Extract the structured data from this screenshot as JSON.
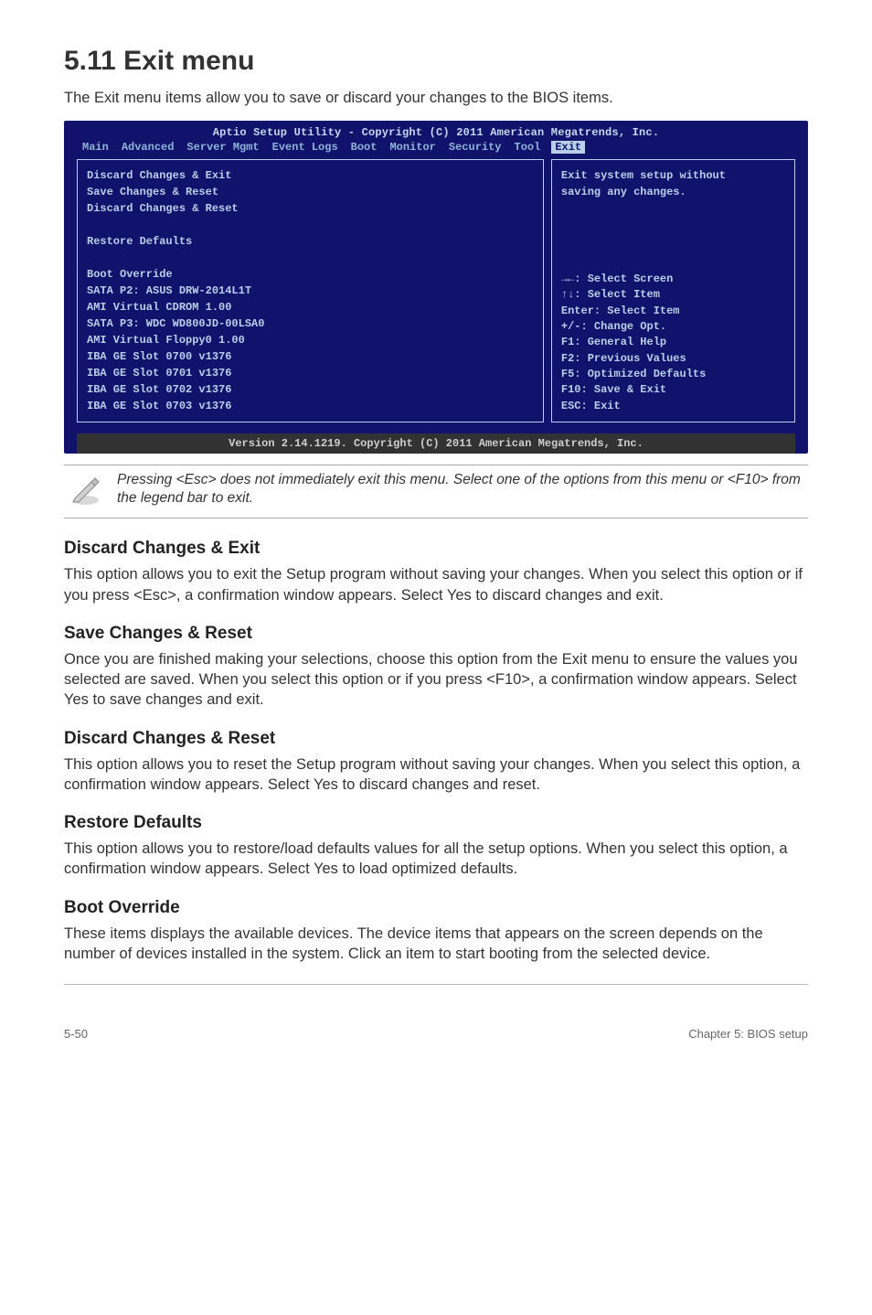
{
  "title": "5.11  Exit menu",
  "intro": "The Exit menu items allow you to save or discard your changes to the BIOS items.",
  "bios": {
    "header": "Aptio Setup Utility - Copyright (C) 2011 American Megatrends, Inc.",
    "tabs": [
      "Main",
      "Advanced",
      "Server Mgmt",
      "Event Logs",
      "Boot",
      "Monitor",
      "Security",
      "Tool",
      "Exit"
    ],
    "active_tab": "Exit",
    "left_lines": [
      {
        "text": "Discard Changes & Exit",
        "bold": true
      },
      {
        "text": "Save Changes & Reset",
        "bold": true
      },
      {
        "text": "Discard Changes & Reset",
        "bold": true
      },
      {
        "text": "",
        "bold": false
      },
      {
        "text": "Restore Defaults",
        "bold": true
      },
      {
        "text": "",
        "bold": false
      },
      {
        "text": "Boot Override",
        "bold": true
      },
      {
        "text": "SATA P2: ASUS    DRW-2014L1T",
        "bold": true
      },
      {
        "text": "AMI Virtual CDROM 1.00",
        "bold": true
      },
      {
        "text": "SATA P3: WDC WD800JD-00LSA0",
        "bold": true
      },
      {
        "text": "AMI Virtual Floppy0 1.00",
        "bold": true
      },
      {
        "text": "IBA GE Slot 0700 v1376",
        "bold": true
      },
      {
        "text": "IBA GE Slot 0701 v1376",
        "bold": true
      },
      {
        "text": "IBA GE Slot 0702 v1376",
        "bold": true
      },
      {
        "text": "IBA GE Slot 0703 v1376",
        "bold": true
      }
    ],
    "right_top": [
      "Exit system setup without",
      "saving any changes."
    ],
    "right_bottom": [
      "→←: Select Screen",
      "↑↓:  Select Item",
      "Enter: Select Item",
      "+/-: Change Opt.",
      "F1: General Help",
      "F2: Previous Values",
      "F5: Optimized Defaults",
      "F10: Save & Exit",
      "ESC: Exit"
    ],
    "footer": "Version 2.14.1219. Copyright (C) 2011 American Megatrends, Inc."
  },
  "note": "Pressing <Esc> does not immediately exit this menu. Select one of the options from this menu or <F10> from the legend bar to exit.",
  "sections": [
    {
      "heading": "Discard Changes & Exit",
      "body": "This option allows you to exit the Setup program without saving your changes. When you select this option or if you press <Esc>, a confirmation window appears. Select Yes to discard changes and exit."
    },
    {
      "heading": "Save Changes & Reset",
      "body": "Once you are finished making your selections, choose this option from the Exit menu to ensure the values you selected are saved. When you select this option or if you press <F10>, a confirmation window appears. Select Yes to save changes and exit."
    },
    {
      "heading": "Discard Changes & Reset",
      "body": "This option allows you to reset the Setup program without saving your changes. When you select this option, a confirmation window appears. Select Yes to discard changes and reset."
    },
    {
      "heading": "Restore Defaults",
      "body": "This option allows you to restore/load defaults values for all the setup options. When you select this option, a confirmation window appears. Select Yes to load optimized defaults."
    },
    {
      "heading": "Boot Override",
      "body": "These items displays the available devices. The device items that appears on the screen depends on the number of devices installed in the system. Click an item to start booting from the selected device."
    }
  ],
  "footer": {
    "left": "5-50",
    "right": "Chapter 5: BIOS setup"
  }
}
